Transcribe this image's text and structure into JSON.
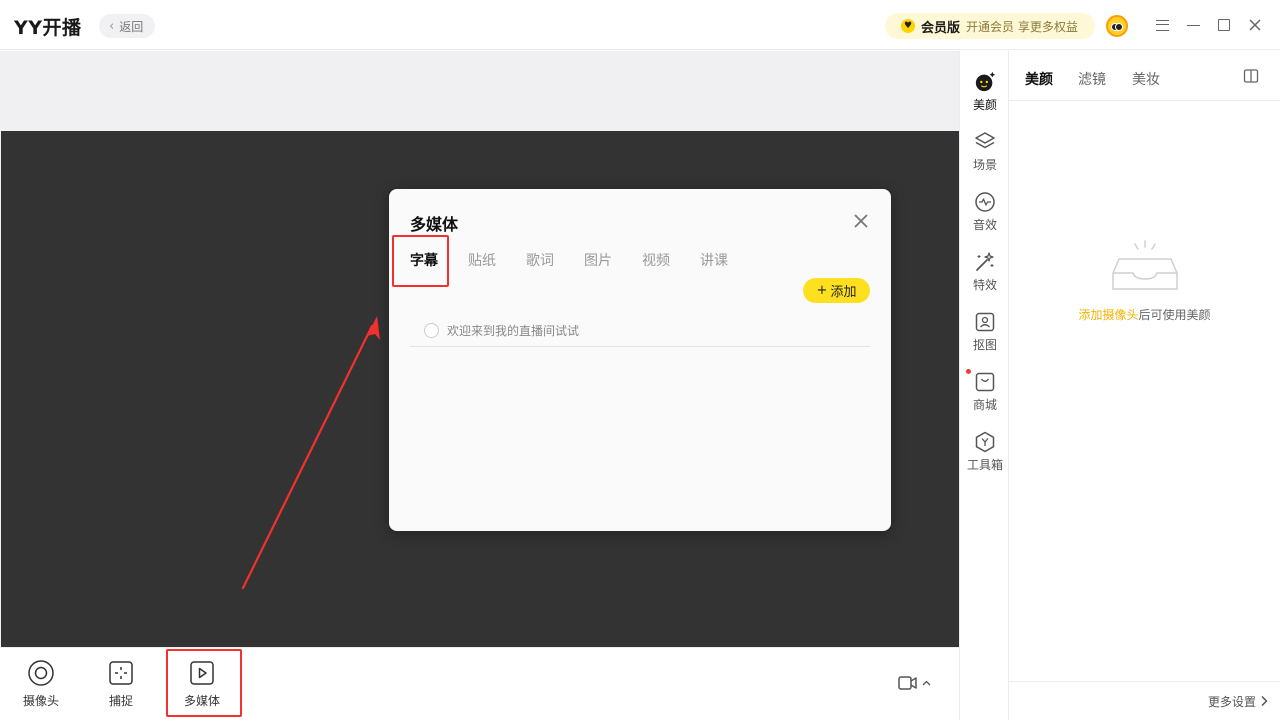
{
  "titlebar": {
    "app_title": "YY开播",
    "back_label": "返回",
    "vip_name": "会员版",
    "vip_desc": "开通会员 享更多权益"
  },
  "bottombar": {
    "tools": [
      {
        "label": "摄像头",
        "icon": "camera-ring-icon"
      },
      {
        "label": "捕捉",
        "icon": "capture-icon"
      },
      {
        "label": "多媒体",
        "icon": "media-play-icon"
      }
    ]
  },
  "right_rail": {
    "items": [
      {
        "label": "美颜",
        "icon": "beauty-face-icon",
        "active": true
      },
      {
        "label": "场景",
        "icon": "layers-icon"
      },
      {
        "label": "音效",
        "icon": "waveform-icon"
      },
      {
        "label": "特效",
        "icon": "magic-wand-icon"
      },
      {
        "label": "抠图",
        "icon": "portrait-cutout-icon"
      },
      {
        "label": "商城",
        "icon": "shopping-bag-icon"
      },
      {
        "label": "工具箱",
        "icon": "toolbox-hex-icon"
      }
    ]
  },
  "right_panel": {
    "tabs": [
      "美颜",
      "滤镜",
      "美妆"
    ],
    "active_tab": "美颜",
    "empty_link": "添加摄像头",
    "empty_suffix": "后可使用美颜",
    "more_settings": "更多设置"
  },
  "modal": {
    "title": "多媒体",
    "tabs": [
      "字幕",
      "贴纸",
      "歌词",
      "图片",
      "视频",
      "讲课"
    ],
    "active_tab": "字幕",
    "add_label": "添加",
    "captions": [
      {
        "text": "欢迎来到我的直播间试试"
      }
    ]
  },
  "colors": {
    "accent_yellow": "#ffe020",
    "highlight_red": "#f23030",
    "preview_bg": "#333333",
    "link_yellow": "#f2b300"
  }
}
